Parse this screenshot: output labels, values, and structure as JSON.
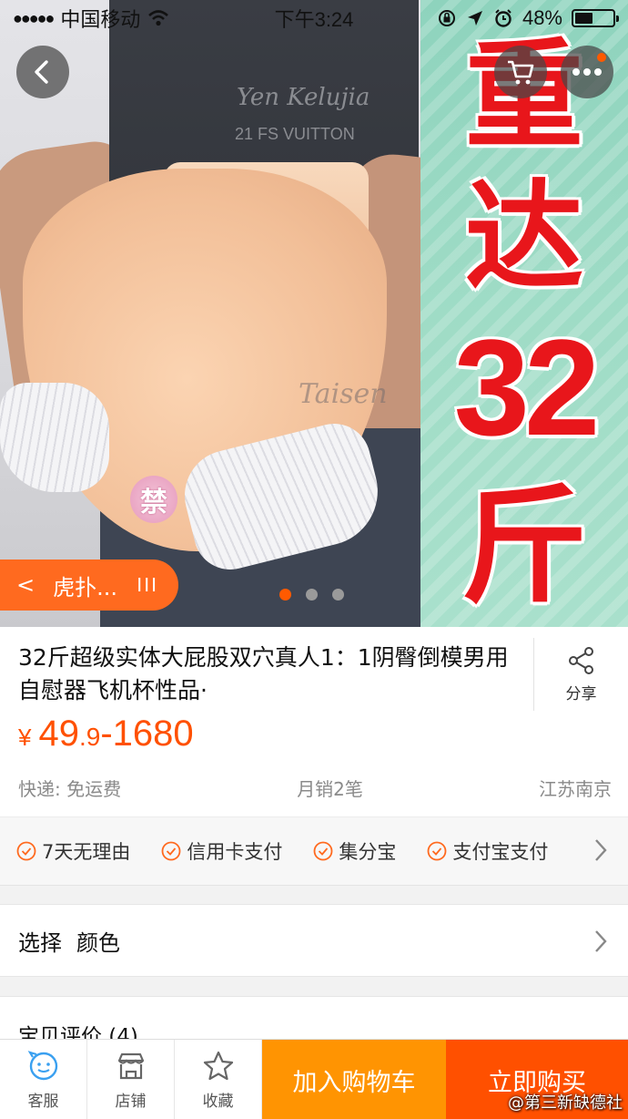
{
  "status_bar": {
    "carrier": "中国移动",
    "time": "下午3:24",
    "battery": "48%",
    "battery_level": 0.48
  },
  "hero": {
    "banner_lines": [
      "重",
      "达",
      "32",
      "斤"
    ],
    "watermark": "Taisen",
    "shirt_print_lines": [
      "Yen Kelujia",
      "21 FS VUITTON"
    ],
    "censor_badge": "禁",
    "shop_pill": {
      "chevron": "<",
      "name": "虎扑...",
      "bars": "III"
    },
    "carousel": {
      "count": 3,
      "active_index": 0
    }
  },
  "product": {
    "title": "32斤超级实体大屁股双穴真人1：1阴臀倒模男用自慰器飞机杯性品·",
    "share_label": "分享",
    "price": {
      "currency": "¥",
      "int": "49",
      "dec": ".9",
      "rest": "-1680"
    },
    "shipping": "快递: 免运费",
    "monthly_sales": "月销2笔",
    "location": "江苏南京"
  },
  "services": [
    "7天无理由",
    "信用卡支付",
    "集分宝",
    "支付宝支付"
  ],
  "select": {
    "label": "选择",
    "value": "颜色"
  },
  "reviews": {
    "title": "宝贝评价 (4)"
  },
  "bottom_bar": {
    "service": "客服",
    "shop": "店铺",
    "favorite": "收藏",
    "add_to_cart": "加入购物车",
    "buy_now": "立即购买"
  },
  "credit": "@第三新缺德社",
  "colors": {
    "accent_orange": "#ff5000",
    "cart_orange": "#ff9402",
    "pill_orange": "#ff6a1f",
    "banner_red": "#e8161b",
    "banner_green": "#9fdcc6"
  }
}
